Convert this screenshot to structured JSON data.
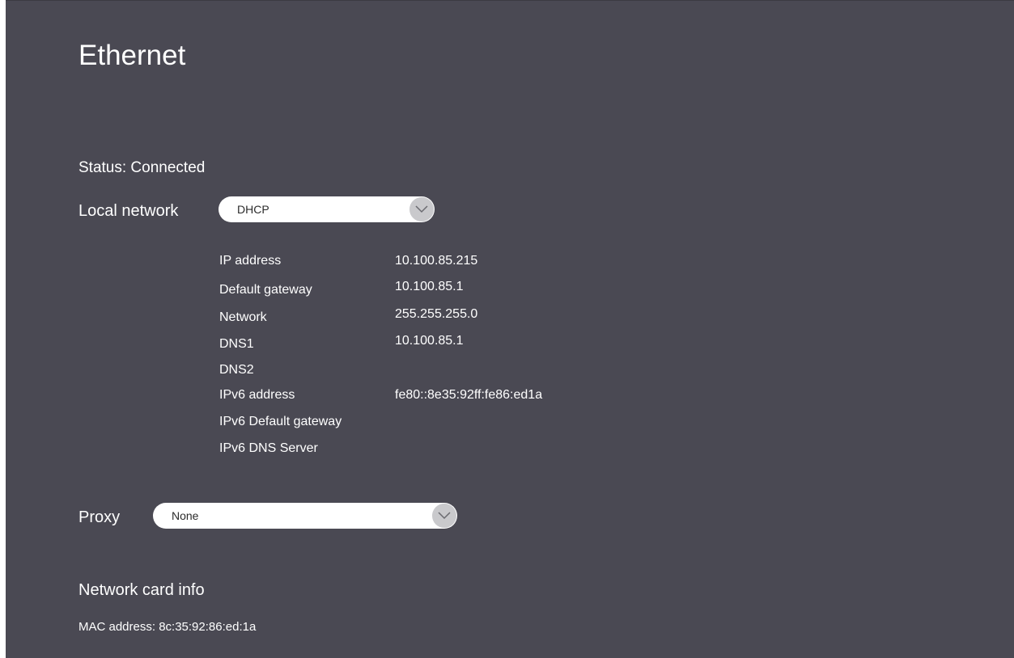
{
  "page": {
    "title": "Ethernet",
    "status": "Status: Connected"
  },
  "local_network": {
    "label": "Local network",
    "selected": "DHCP"
  },
  "details": [
    {
      "label": "IP address",
      "value": "10.100.85.215"
    },
    {
      "label": "Default gateway",
      "value": "10.100.85.1"
    },
    {
      "label": "Network",
      "value": "255.255.255.0"
    },
    {
      "label": "DNS1",
      "value": "10.100.85.1"
    },
    {
      "label": "DNS2",
      "value": ""
    },
    {
      "label": "IPv6 address",
      "value": "fe80::8e35:92ff:fe86:ed1a"
    },
    {
      "label": "IPv6 Default gateway",
      "value": ""
    },
    {
      "label": "IPv6 DNS Server",
      "value": ""
    }
  ],
  "proxy": {
    "label": "Proxy",
    "selected": "None"
  },
  "network_card": {
    "heading": "Network card info",
    "mac": "MAC address: 8c:35:92:86:ed:1a"
  },
  "icons": {
    "dropdown": "chevron-down-icon"
  },
  "colors": {
    "background": "#4a4953",
    "text": "#ffffff",
    "dropdown_bg": "#ffffff",
    "chevron_bg": "#c9c9cc"
  }
}
